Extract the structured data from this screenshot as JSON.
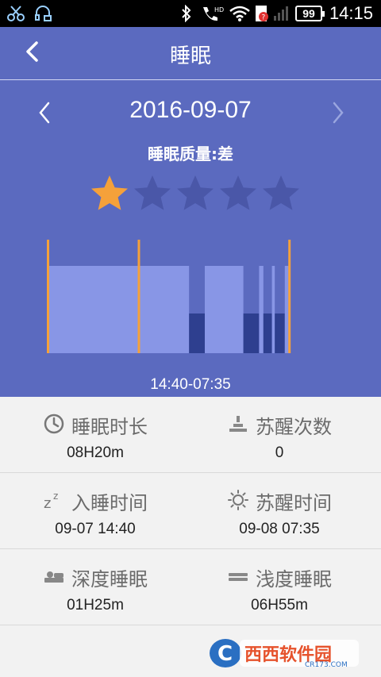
{
  "status_bar": {
    "time": "14:15",
    "battery": "99",
    "icons": [
      "scissors-icon",
      "headset-icon",
      "bluetooth-icon",
      "phone-signal-icon",
      "wifi-icon",
      "sim-icon",
      "signal-icon",
      "battery-icon"
    ]
  },
  "app_bar": {
    "back_icon": "chevron-left-icon",
    "title": "睡眠"
  },
  "header": {
    "date": "2016-09-07",
    "prev_icon": "chevron-left-icon",
    "next_icon": "chevron-right-icon",
    "quality_label": "睡眠质量:差",
    "rating": 1,
    "rating_max": 5
  },
  "chart_data": {
    "type": "bar",
    "colors": {
      "light": "#8896e6",
      "deep": "#2e3f8f",
      "marker": "#f5a13a"
    },
    "segments": [
      {
        "start": 0.0,
        "end": 0.495,
        "level": "light"
      },
      {
        "start": 0.495,
        "end": 0.55,
        "level": "deep"
      },
      {
        "start": 0.55,
        "end": 0.685,
        "level": "light"
      },
      {
        "start": 0.685,
        "end": 0.74,
        "level": "deep"
      },
      {
        "start": 0.74,
        "end": 0.755,
        "level": "light"
      },
      {
        "start": 0.755,
        "end": 0.785,
        "level": "deep"
      },
      {
        "start": 0.785,
        "end": 0.795,
        "level": "light"
      },
      {
        "start": 0.795,
        "end": 0.83,
        "level": "deep"
      },
      {
        "start": 0.83,
        "end": 0.845,
        "level": "light"
      }
    ],
    "markers": [
      0.0,
      0.318,
      0.845
    ],
    "time_range": "14:40-07:35"
  },
  "stats": [
    {
      "icon": "clock-icon",
      "label": "睡眠时长",
      "value": "08H20m"
    },
    {
      "icon": "wake-count-icon",
      "label": "苏醒次数",
      "value": "0"
    },
    {
      "icon": "zzz-icon",
      "label": "入睡时间",
      "value": "09-07 14:40"
    },
    {
      "icon": "sun-icon",
      "label": "苏醒时间",
      "value": "09-08 07:35"
    },
    {
      "icon": "deep-sleep-icon",
      "label": "深度睡眠",
      "value": "01H25m"
    },
    {
      "icon": "light-sleep-icon",
      "label": "浅度睡眠",
      "value": "06H55m"
    }
  ],
  "watermark": {
    "brand": "西西软件园",
    "url": "CR173.COM"
  },
  "colors": {
    "primary": "#5b6abf",
    "star_active": "#f5a13a",
    "star_inactive": "#4a57a8"
  }
}
